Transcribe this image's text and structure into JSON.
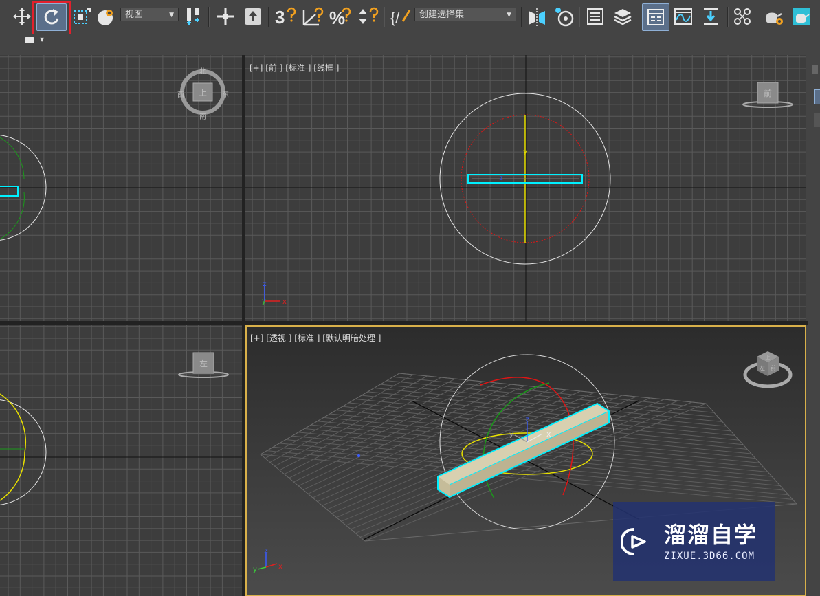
{
  "toolbar": {
    "view_dropdown": "视图",
    "selection_set_dropdown": "创建选择集",
    "snap_3d_label": "3",
    "percent_snap_label": "%",
    "named_sets_label": "{/"
  },
  "viewports": {
    "top": {
      "nav_labels": [
        "北",
        "西",
        "上",
        "东",
        "南"
      ]
    },
    "front": {
      "label": "[+] [前 ] [标准 ] [线框 ]",
      "cube_label": "前"
    },
    "left": {
      "cube_label": "左"
    },
    "perspective": {
      "label": "[+] [透视 ] [标准 ] [默认明暗处理 ]",
      "cube_labels": [
        "上",
        "左",
        "前"
      ]
    }
  },
  "axes": {
    "x": "x",
    "y": "y",
    "z": "z"
  },
  "watermark": {
    "title": "溜溜自学",
    "subtitle": "ZIXUE.3D66.COM"
  },
  "colors": {
    "viewport_bg": "#3d3d3d",
    "grid": "#5a5a5a",
    "selection_cyan": "#00f0ff",
    "highlight_red": "#e3202c",
    "gizmo_red": "#e01515",
    "gizmo_green": "#1a9a1a",
    "gizmo_yellow": "#e8e000",
    "box_color": "#d8d0b0"
  }
}
